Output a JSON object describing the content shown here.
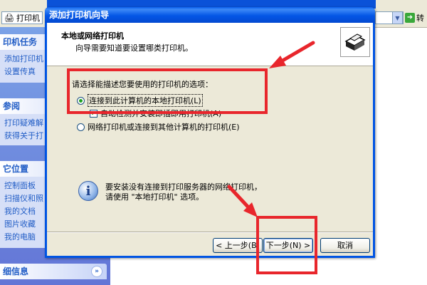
{
  "explorer": {
    "address_label": "打印机",
    "go_label": "转",
    "sidebar": {
      "printer_tasks": {
        "title": "印机任务",
        "links": [
          "添加打印机",
          "设置传真"
        ]
      },
      "see_also": {
        "title": "参阅",
        "links": [
          "打印疑难解",
          "获得关于打"
        ]
      },
      "other_places": {
        "title": "它位置",
        "links": [
          "控制面板",
          "扫描仪和照",
          "我的文档",
          "图片收藏",
          "我的电脑"
        ]
      },
      "details": {
        "title": "细信息"
      }
    }
  },
  "wizard": {
    "title": "添加打印机向导",
    "header_title": "本地或网络打印机",
    "header_subtitle": "向导需要知道要设置哪类打印机。",
    "prompt": "请选择能描述您要使用的打印机的选项：",
    "option_local": "连接到此计算机的本地打印机(L)",
    "option_local_selected": true,
    "auto_detect": "自动检测并安装即插即用打印机(A)",
    "auto_detect_checked": true,
    "option_network": "网络打印机或连接到其他计算机的打印机(E)",
    "option_network_selected": false,
    "info_line1": "要安装没有连接到打印服务器的网络打印机，",
    "info_line2": "请使用 \"本地打印机\" 选项。",
    "buttons": {
      "back": "< 上一步(B)",
      "next": "下一步(N) >",
      "cancel": "取消"
    }
  },
  "annotation_color": "#e8262c"
}
